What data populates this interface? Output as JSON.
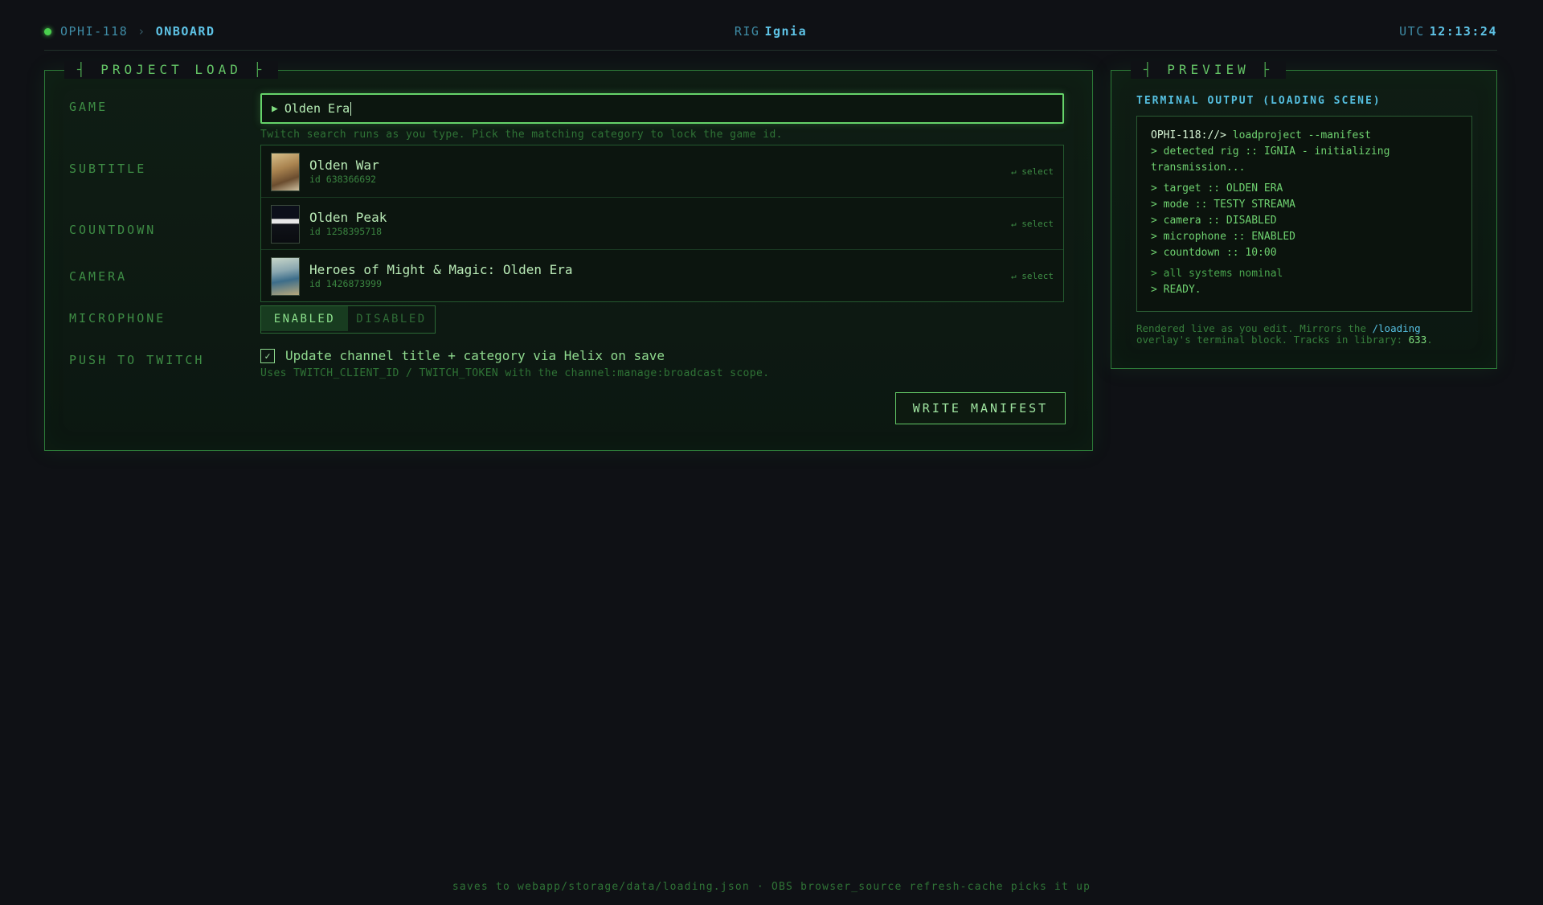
{
  "topbar": {
    "station_id": "OPHI-118",
    "separator": "›",
    "current": "ONBOARD",
    "rig_label": "RIG",
    "rig_name": "Ignia",
    "utc_label": "UTC",
    "utc_time": "12:13:24"
  },
  "project": {
    "legend_left": "┤",
    "legend": "PROJECT LOAD",
    "legend_right": "├",
    "labels": {
      "game": "GAME",
      "subtitle": "SUBTITLE",
      "countdown": "COUNTDOWN",
      "camera": "CAMERA",
      "microphone": "MICROPHONE",
      "push": "PUSH TO TWITCH"
    },
    "game_input": {
      "arrow": "▶",
      "value": "Olden Era"
    },
    "search_hint": "Twitch search runs as you type. Pick the matching category to lock the game id.",
    "results": [
      {
        "name": "Olden War",
        "id": "id 638366692",
        "action": "↵ select"
      },
      {
        "name": "Olden Peak",
        "id": "id 1258395718",
        "action": "↵ select"
      },
      {
        "name": "Heroes of Might & Magic: Olden Era",
        "id": "id 1426873999",
        "action": "↵ select"
      }
    ],
    "microphone_toggle": {
      "enabled": "ENABLED",
      "disabled": "DISABLED",
      "selected": "ENABLED"
    },
    "push": {
      "checked": true,
      "check_mark": "✓",
      "label": "Update channel title + category via Helix on save",
      "hint": "Uses TWITCH_CLIENT_ID / TWITCH_TOKEN with the channel:manage:broadcast scope."
    },
    "write_button": "WRITE MANIFEST"
  },
  "preview": {
    "legend_left": "┤",
    "legend": "PREVIEW",
    "legend_right": "├",
    "heading": "TERMINAL OUTPUT (LOADING SCENE)",
    "terminal": {
      "prompt": "OPHI-118://>",
      "command": " loadproject --manifest",
      "lines": [
        "> detected rig :: IGNIA - initializing transmission...",
        "> target :: OLDEN ERA",
        "> mode :: TESTY STREAMA",
        "> camera :: DISABLED",
        "> microphone :: ENABLED",
        "> countdown :: 10:00",
        "> all systems nominal",
        "> READY."
      ]
    },
    "note_prefix": "Rendered live as you edit. Mirrors the ",
    "note_link": "/loading",
    "note_middle": " overlay's terminal block. Tracks in library: ",
    "note_count": "633",
    "note_suffix": "."
  },
  "footer": "saves to webapp/storage/data/loading.json · OBS browser_source refresh-cache picks it up",
  "colors": {
    "background": "#0f1115",
    "accent_green": "#5fbf62",
    "accent_cyan": "#5ec3e6",
    "status_dot": "#4ad04e"
  }
}
